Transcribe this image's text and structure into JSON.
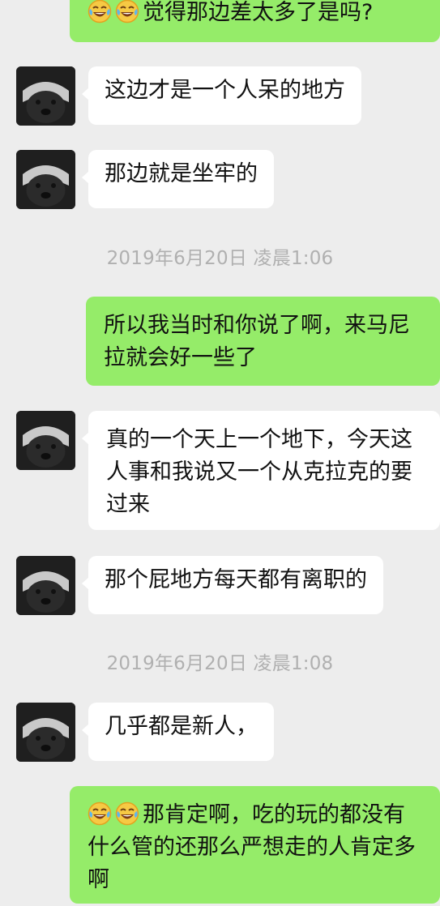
{
  "messages": {
    "m1": {
      "emoji": "😂😂",
      "text": "觉得那边差太多了是吗?"
    },
    "m2": {
      "text": "这边才是一个人呆的地方"
    },
    "m3": {
      "text": "那边就是坐牢的"
    },
    "ts1": "2019年6月20日 凌晨1:06",
    "m4": {
      "text": "所以我当时和你说了啊，来马尼拉就会好一些了"
    },
    "m5": {
      "text": "真的一个天上一个地下，今天这人事和我说又一个从克拉克的要过来"
    },
    "m6": {
      "text": "那个屁地方每天都有离职的"
    },
    "ts2": "2019年6月20日 凌晨1:08",
    "m7": {
      "text": "几乎都是新人，"
    },
    "m8": {
      "emoji": "😂😂",
      "text": "那肯定啊，吃的玩的都没有什么管的还那么严想走的人肯定多啊"
    }
  },
  "colors": {
    "background": "#ededed",
    "outgoing_bubble": "#95ec69",
    "incoming_bubble": "#ffffff",
    "timestamp_text": "#b0b0b0"
  },
  "icons": {
    "contact_avatar": "honey-badger-avatar-icon",
    "emoji": "tears-of-joy-emoji-icon"
  }
}
